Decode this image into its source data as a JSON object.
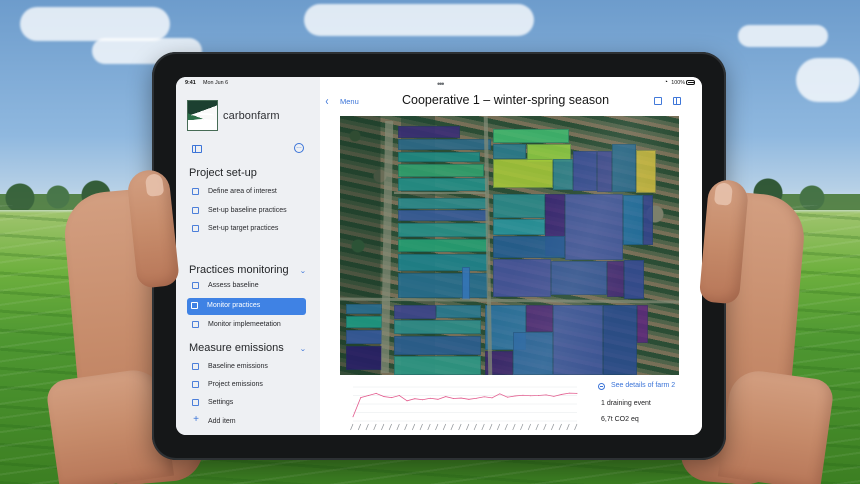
{
  "device": {
    "status": {
      "time": "9:41",
      "date": "Mon Jun 6",
      "battery": "100%",
      "icons": [
        "wifi-icon",
        "battery-icon"
      ]
    }
  },
  "app": {
    "brand": "carbonfarm",
    "icons": {
      "logo": "carbonfarm-logo",
      "sidebar": "sidebar-toggle-icon",
      "more": "more-icon",
      "back": "chevron-left-icon",
      "add": "plus-icon",
      "details": "info-circle-icon"
    }
  },
  "sidebar": {
    "sections": [
      {
        "title": "Project set-up",
        "expanded": true,
        "items": [
          {
            "label": "Define area of interest",
            "active": false
          },
          {
            "label": "Set-up baseline practices",
            "active": false
          },
          {
            "label": "Set-up target practices",
            "active": false
          }
        ]
      },
      {
        "title": "Practices monitoring",
        "expanded": true,
        "items": [
          {
            "label": "Assess baseline",
            "active": false
          },
          {
            "label": "Monitor practices",
            "active": true
          },
          {
            "label": "Monitor implemeetation",
            "active": false
          }
        ]
      },
      {
        "title": "Measure emissions",
        "expanded": true,
        "items": [
          {
            "label": "Baseline emissions",
            "active": false
          },
          {
            "label": "Project emissions",
            "active": false
          },
          {
            "label": "Settings",
            "active": false
          }
        ]
      }
    ],
    "add_item": "Add item"
  },
  "main": {
    "back_label": "Menu",
    "title": "Cooperative 1 – winter-spring season",
    "details_link": "See details of farm 2",
    "event": "1 draining event",
    "emissions": "6,7t CO2 eq"
  },
  "chart_data": {
    "type": "line",
    "series": [
      {
        "color": "#e35b8e",
        "values": [
          2,
          11,
          12,
          13,
          11.5,
          11,
          12,
          9.5,
          10.5,
          10,
          10.7,
          10.2,
          11.5,
          10.6,
          10.8,
          10.2,
          10.7,
          11.4,
          10.9,
          12.8,
          11.2,
          11.8,
          12.1,
          11.9,
          12.0,
          12.3,
          11.6,
          12.5,
          13.1,
          13.0
        ]
      }
    ],
    "ylim": [
      0,
      16
    ],
    "grid": true
  },
  "colors": {
    "accent": "#3f82e4",
    "sidebar_bg": "#eef0f3",
    "chart_line": "#e35b8e"
  }
}
